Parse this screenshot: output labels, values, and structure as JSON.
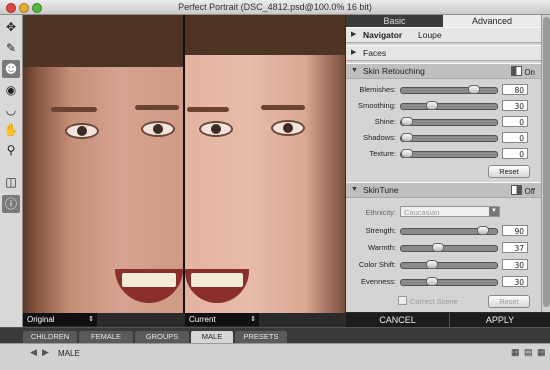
{
  "window": {
    "title": "Perfect Portrait (DSC_4812.psd@100.0% 16 bit)"
  },
  "toolbar": {
    "tools": [
      {
        "name": "move-tool-icon",
        "glyph": "✥"
      },
      {
        "name": "brush-tool-icon",
        "glyph": "✎"
      },
      {
        "name": "skin-portrait-tool-icon",
        "glyph": "☻"
      },
      {
        "name": "eye-tool-icon",
        "glyph": "◉"
      },
      {
        "name": "mouth-tool-icon",
        "glyph": "◡"
      },
      {
        "name": "hand-tool-icon",
        "glyph": "✋"
      },
      {
        "name": "zoom-tool-icon",
        "glyph": "⚲"
      },
      {
        "name": "compare-view-icon",
        "glyph": "◫"
      },
      {
        "name": "info-icon",
        "glyph": "ⓘ"
      }
    ]
  },
  "canvas": {
    "left_view": "Original",
    "right_view": "Current"
  },
  "panel": {
    "tabs": {
      "basic": "Basic",
      "advanced": "Advanced"
    },
    "navigator": {
      "label": "Navigator",
      "loupe": "Loupe"
    },
    "faces": {
      "label": "Faces"
    },
    "skin_retouching": {
      "label": "Skin Retouching",
      "switch": "On",
      "sliders": [
        {
          "label": "Blemishes:",
          "value": "80",
          "level": 0.8
        },
        {
          "label": "Smoothing:",
          "value": "30",
          "level": 0.3
        },
        {
          "label": "Shine:",
          "value": "0",
          "level": 0.0
        },
        {
          "label": "Shadows:",
          "value": "0",
          "level": 0.0
        },
        {
          "label": "Texture:",
          "value": "0",
          "level": 0.0
        }
      ],
      "reset": "Reset"
    },
    "skintune": {
      "label": "SkinTune",
      "switch": "Off",
      "ethnicity_label": "Ethnicity:",
      "ethnicity_value": "Caucasian",
      "sliders": [
        {
          "label": "Strength:",
          "value": "90",
          "level": 0.9
        },
        {
          "label": "Warmth:",
          "value": "37",
          "level": 0.37
        },
        {
          "label": "Color Shift:",
          "value": "30",
          "level": 0.3
        },
        {
          "label": "Evenness:",
          "value": "30",
          "level": 0.3
        }
      ],
      "correct_scene": "Correct Scene",
      "reset": "Reset"
    },
    "cancel": "CANCEL",
    "apply": "APPLY"
  },
  "presets": {
    "tabs": [
      "CHILDREN",
      "FEMALE",
      "GROUPS",
      "MALE",
      "PRESETS"
    ],
    "active": "MALE",
    "current": "MALE"
  },
  "colors": {
    "accent_dark": "#1c1c1c",
    "panel_bg": "#d4d4d4",
    "slider_track": "#8a8a8a"
  }
}
